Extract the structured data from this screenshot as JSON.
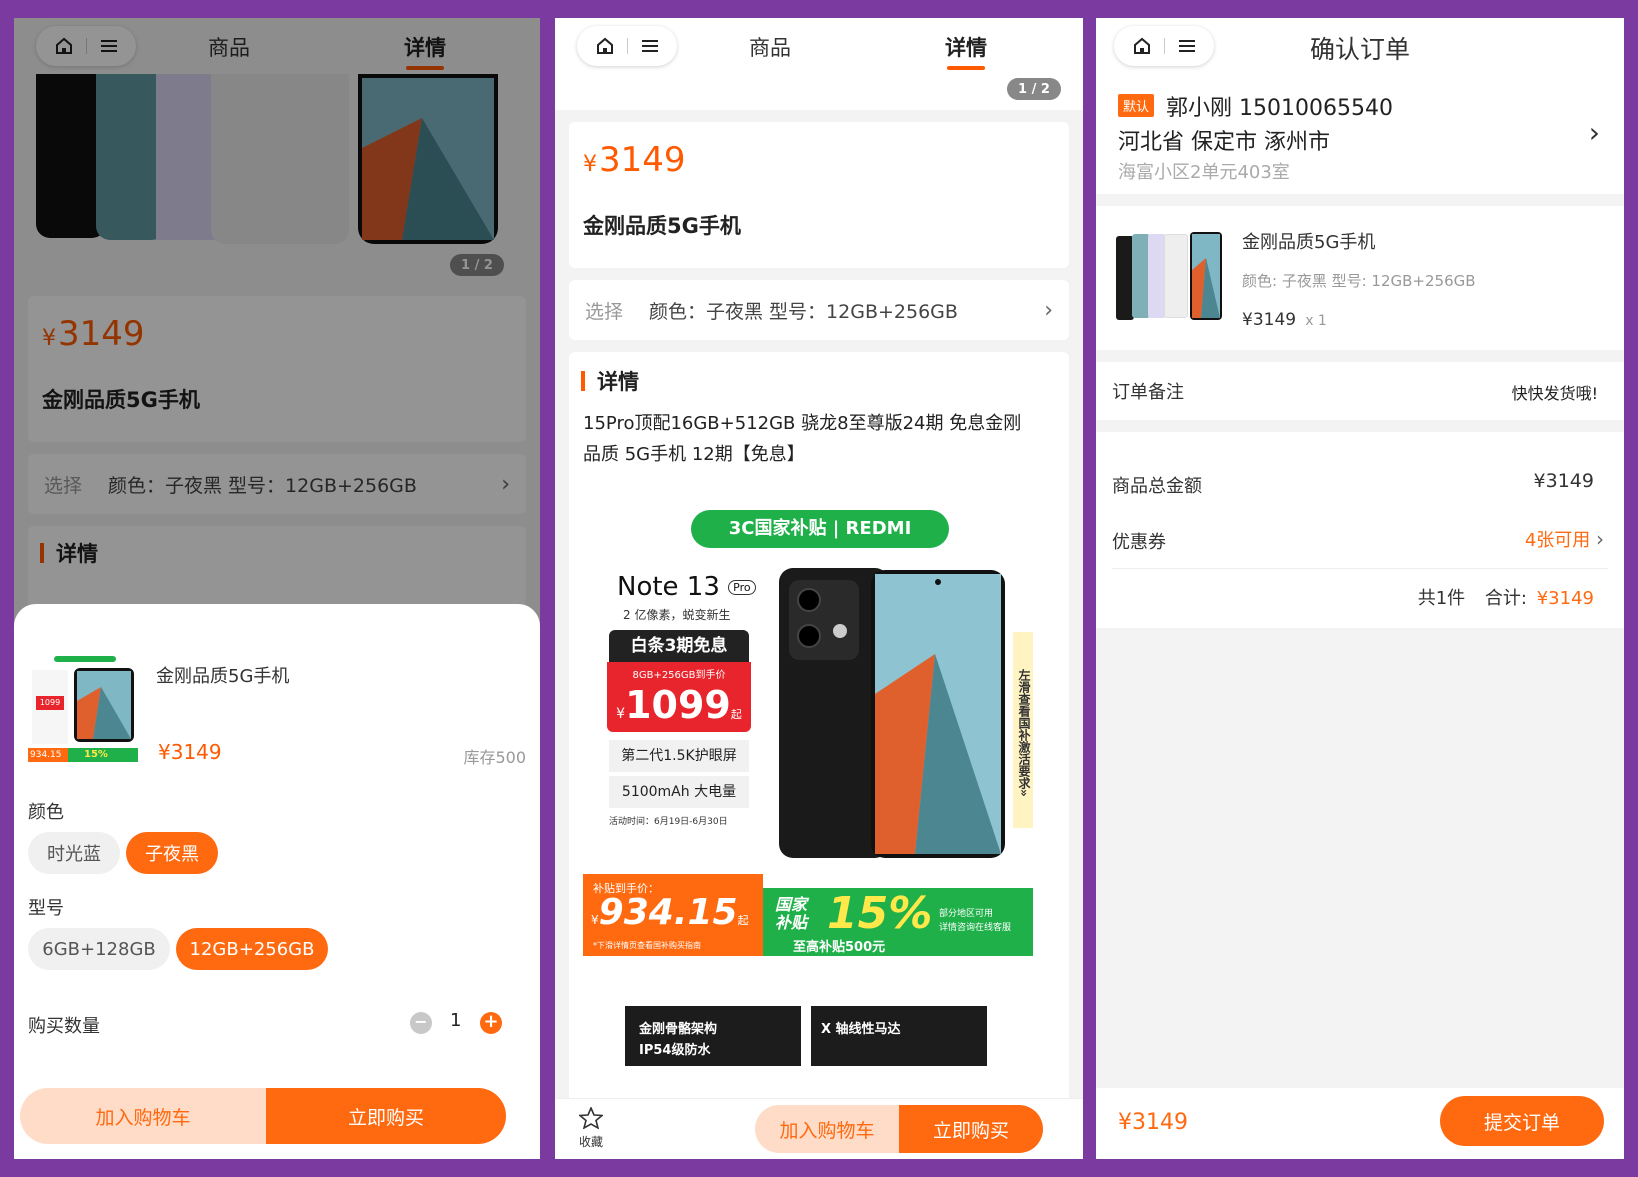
{
  "nav": {
    "tab_goods": "商品",
    "tab_detail": "详情",
    "confirm_title": "确认订单"
  },
  "product": {
    "yen": "¥",
    "price": "3149",
    "name": "金刚品质5G手机",
    "pager": "1 / 2",
    "select_label": "选择",
    "select_value": "颜色：子夜黑 型号：12GB+256GB"
  },
  "detail": {
    "title": "详情",
    "description": "15Pro顶配16GB+512GB 骁龙8至尊版24期 免息金刚品质 5G手机 12期【免息】"
  },
  "promo": {
    "banner": "3C国家补贴 | REDMI",
    "model": "Note 13",
    "model_badge": "Pro",
    "tagline": "2 亿像素，蜕变新生",
    "installment": "白条3期免息",
    "config_price_label": "8GB+256GB到手价",
    "price": "1099",
    "price_suffix": "起",
    "feature1": "第二代1.5K护眼屏",
    "feature2": "5100mAh 大电量",
    "activity_time": "活动时间：6月19日-6月30日",
    "side_text": "左滑查看国补激活要求»",
    "subsidy_label": "补贴到手价：",
    "subsidy_price": "934.15",
    "subsidy_price_suffix": "起",
    "subsidy_note": "*下滑详情页查看国补购买指南",
    "national_subsidy": "国家补贴",
    "percent": "15%",
    "max_subsidy": "至高补贴500元",
    "region_note1": "部分地区可用",
    "region_note2": "详情咨询在线客服",
    "feature_tile1_line1": "金刚骨骼架构",
    "feature_tile1_line2": "IP54级防水",
    "feature_tile2": "X 轴线性马达"
  },
  "sheet": {
    "name": "金刚品质5G手机",
    "price": "¥3149",
    "stock": "库存500",
    "color_label": "颜色",
    "colors": [
      "时光蓝",
      "子夜黑"
    ],
    "model_label": "型号",
    "models": [
      "6GB+128GB",
      "12GB+256GB"
    ],
    "qty_label": "购买数量",
    "qty": "1",
    "minus": "−",
    "plus": "+",
    "thumb_price": "934.15",
    "thumb_pct": "15%",
    "thumb_price2": "1099"
  },
  "actions": {
    "add_cart": "加入购物车",
    "buy_now": "立即购买",
    "favorite": "收藏",
    "submit": "提交订单"
  },
  "order": {
    "default_tag": "默认",
    "receiver": "郭小刚 15010065540",
    "region": "河北省 保定市 涿州市",
    "address": "海富小区2单元403室",
    "item_name": "金刚品质5G手机",
    "item_spec": "颜色: 子夜黑 型号: 12GB+256GB",
    "item_price": "¥3149",
    "item_qty": "x 1",
    "remark_label": "订单备注",
    "remark_value": "快快发货哦!",
    "total_label": "商品总金额",
    "total_value": "¥3149",
    "coupon_label": "优惠券",
    "coupon_value": "4张可用",
    "count_text": "共1件",
    "sum_label": "合计:",
    "sum_value": "¥3149",
    "footer_price": "¥3149"
  },
  "colors": {
    "accent": "#ff6a10",
    "background": "#7b3aa0",
    "green": "#1fb04a",
    "red": "#e8242c"
  }
}
